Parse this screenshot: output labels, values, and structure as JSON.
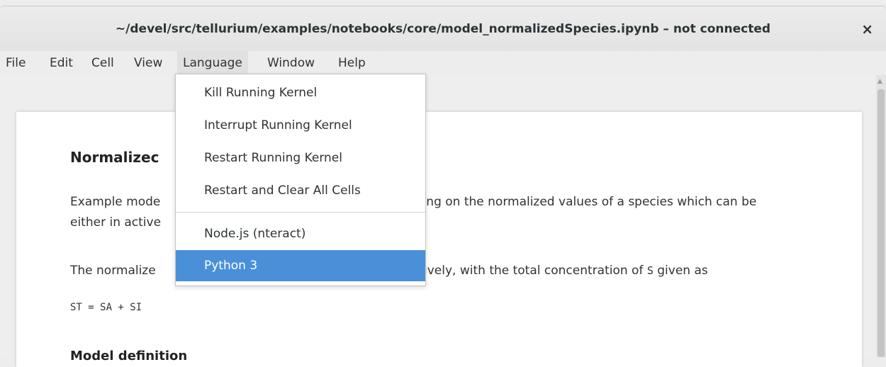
{
  "window": {
    "title": "~/devel/src/tellurium/examples/notebooks/core/model_normalizedSpecies.ipynb – not connected",
    "close_glyph": "×"
  },
  "menubar": {
    "items": [
      "File",
      "Edit",
      "Cell",
      "View",
      "Language",
      "Window",
      "Help"
    ],
    "active": "Language"
  },
  "language_menu": {
    "items": [
      "Kill Running Kernel",
      "Interrupt Running Kernel",
      "Restart Running Kernel",
      "Restart and Clear All Cells",
      "Node.js (nteract)",
      "Python 3"
    ],
    "selected": "Python 3"
  },
  "notebook": {
    "heading_visible": "Normalizec",
    "para1_left": "Example mode",
    "para1_right": "nding on the normalized values of a species which can be",
    "para1_line2": "either in active",
    "para2_left": "The normalize",
    "para2_right": "ctively, with the total concentration of ",
    "para2_code": "S",
    "para2_tail": " given as",
    "equation": "ST = SA + SI",
    "subheading": "Model definition"
  },
  "colors": {
    "selected_bg": "#4a90d9",
    "menu_active_bg": "#e1e1e1"
  }
}
